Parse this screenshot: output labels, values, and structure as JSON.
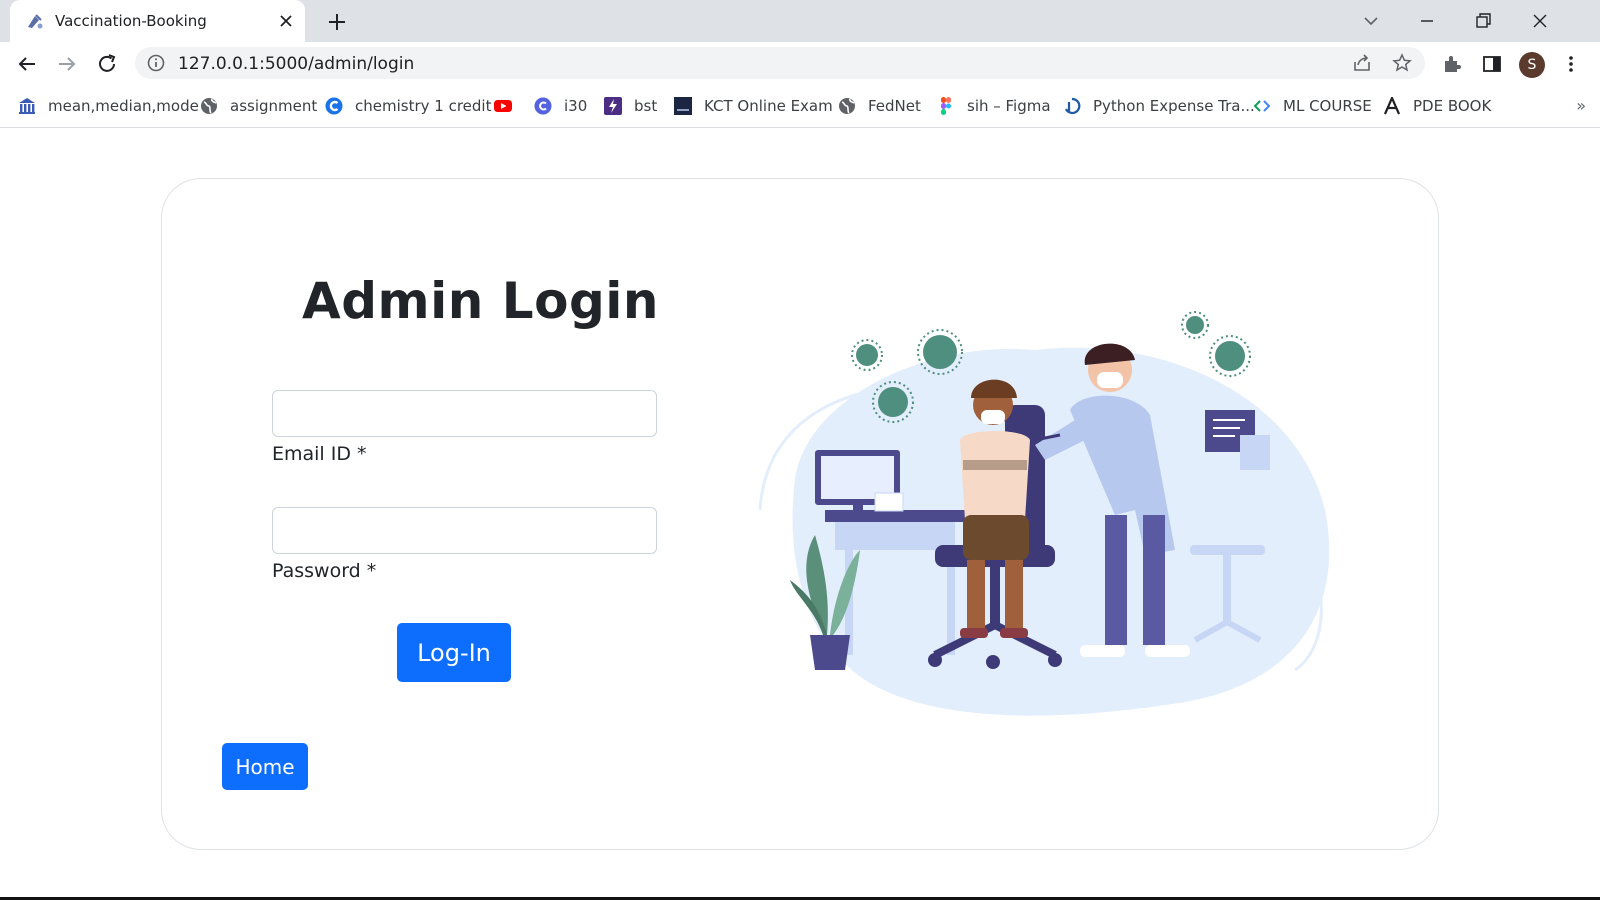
{
  "browser": {
    "tab_title": "Vaccination-Booking",
    "url": "127.0.0.1:5000/admin/login",
    "profile_initial": "S",
    "bookmarks": [
      {
        "label": "mean,median,mode",
        "icon": "bank-icon"
      },
      {
        "label": "assignment",
        "icon": "globe-icon"
      },
      {
        "label": "chemistry 1 credit",
        "icon": "c-logo-icon"
      },
      {
        "label": "",
        "icon": "youtube-icon"
      },
      {
        "label": "i30",
        "icon": "canva-icon"
      },
      {
        "label": "bst",
        "icon": "bolt-icon"
      },
      {
        "label": "KCT Online Exam",
        "icon": "exam-portal-icon"
      },
      {
        "label": "FedNet",
        "icon": "globe-icon"
      },
      {
        "label": "sih – Figma",
        "icon": "figma-icon"
      },
      {
        "label": "Python Expense Tra...",
        "icon": "replit-icon"
      },
      {
        "label": "ML COURSE",
        "icon": "code-brackets-icon"
      },
      {
        "label": "PDE BOOK",
        "icon": "letter-a-icon"
      }
    ],
    "more_bookmarks": "»"
  },
  "page": {
    "heading": "Admin Login",
    "email_label": "Email ID *",
    "email_value": "",
    "password_label": "Password *",
    "password_value": "",
    "login_button": "Log-In",
    "home_button": "Home"
  },
  "colors": {
    "primary": "#0d6efd",
    "tabstrip": "#dee1e6",
    "illustration_blob": "#e3eefc",
    "virus": "#4f8f7f"
  }
}
